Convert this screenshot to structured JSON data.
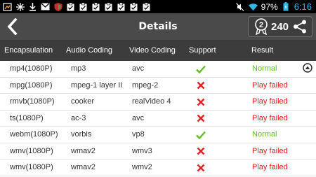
{
  "status_bar": {
    "battery": "97%",
    "time": "6:16",
    "icons_left": [
      "screenshot-icon",
      "snowflake-icon",
      "download-icon",
      "gmail-icon",
      "shield-icon",
      "clipboard-check-icon",
      "clipboard-check-icon",
      "clipboard-check-icon",
      "clipboard-check-icon",
      "clipboard-check-icon",
      "clipboard-check-icon",
      "clipboard-check-icon"
    ],
    "icons_right": [
      "mute-icon",
      "wifi-icon",
      "battery-icon"
    ]
  },
  "header": {
    "title": "Details",
    "score": "240",
    "score_icon": "medal-2-icon",
    "back_icon": "chevron-left-icon",
    "share_icon": "share-icon"
  },
  "table": {
    "columns": [
      "Encapsulation",
      "Audio Coding",
      "Video Coding",
      "Support",
      "Result"
    ],
    "rows": [
      {
        "encapsulation": "mp4(1080P)",
        "audio": "mp3",
        "video": "avc",
        "support": "check",
        "result": "Normal"
      },
      {
        "encapsulation": "mpg(1080P)",
        "audio": "mpeg-1 layer II",
        "video": "mpeg-2",
        "support": "cross",
        "result": "Play failed"
      },
      {
        "encapsulation": "rmvb(1080P)",
        "audio": "cooker",
        "video": "realVideo 4",
        "support": "cross",
        "result": "Play failed"
      },
      {
        "encapsulation": "ts(1080P)",
        "audio": "ac-3",
        "video": "avc",
        "support": "cross",
        "result": "Play failed"
      },
      {
        "encapsulation": "webm(1080P)",
        "audio": "vorbis",
        "video": "vp8",
        "support": "check",
        "result": "Normal"
      },
      {
        "encapsulation": "wmv(1080P)",
        "audio": "wmav2",
        "video": "wmv3",
        "support": "cross",
        "result": "Play failed"
      },
      {
        "encapsulation": "wmv(1080P)",
        "audio": "wmav2",
        "video": "wmv2",
        "support": "cross",
        "result": "Play failed"
      }
    ]
  },
  "colors": {
    "title_bar": "#4a4a4a",
    "table_header": "#3c3c3c",
    "normal": "#66bb22",
    "failed": "#e02020",
    "time": "#33b5e5"
  }
}
